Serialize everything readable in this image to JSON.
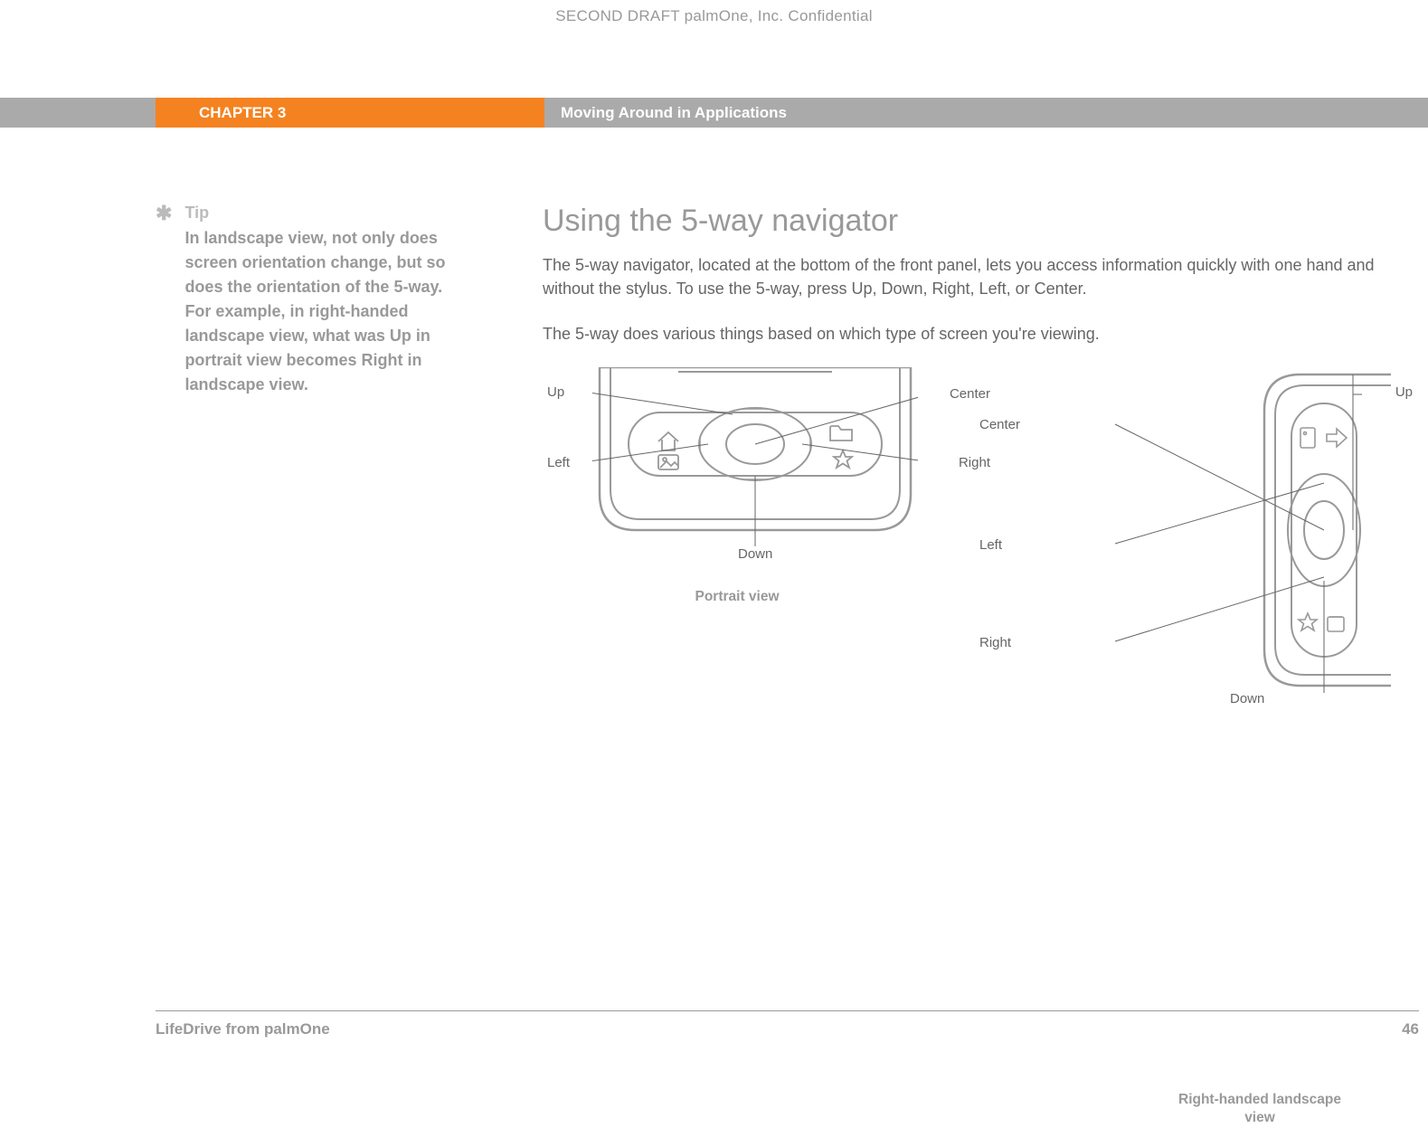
{
  "header": {
    "watermark": "SECOND DRAFT palmOne, Inc.  Confidential",
    "chapter_label": "CHAPTER 3",
    "chapter_title": "Moving Around in Applications"
  },
  "sidebar": {
    "tip_label": "Tip",
    "tip_text": "In landscape view, not only does screen orientation change, but so does the orientation of the 5-way. For example, in right-handed landscape view, what was Up in portrait view becomes Right in landscape view."
  },
  "main": {
    "title": "Using the 5-way navigator",
    "para1": "The 5-way navigator, located at the bottom of the front panel, lets you access information quickly with one hand and without the stylus. To use the 5-way, press Up, Down, Right, Left, or Center.",
    "para2": "The 5-way does various things based on which type of screen you're viewing."
  },
  "diagram_portrait": {
    "up": "Up",
    "down": "Down",
    "left": "Left",
    "right": "Right",
    "center": "Center",
    "caption": "Portrait view"
  },
  "diagram_landscape": {
    "up": "Up",
    "down": "Down",
    "left": "Left",
    "right": "Right",
    "center": "Center",
    "caption": "Right-handed landscape view"
  },
  "footer": {
    "product": "LifeDrive from palmOne",
    "page": "46"
  }
}
